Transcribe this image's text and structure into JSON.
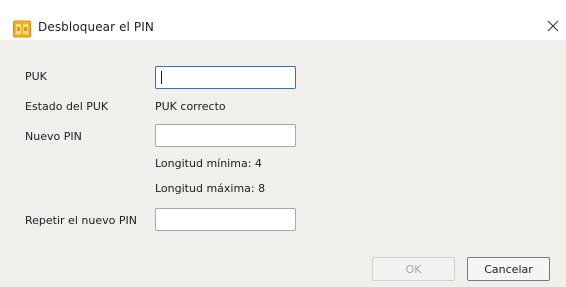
{
  "window": {
    "title": "Desbloquear el PIN",
    "icon": "smartcard-app-icon",
    "close_icon": "close-icon"
  },
  "form": {
    "puk_label": "PUK",
    "puk_value": "",
    "puk_status_label": "Estado del  PUK",
    "puk_status_value": "PUK correcto",
    "new_pin_label": "Nuevo PIN",
    "new_pin_value": "",
    "min_length": "Longitud mínima: 4",
    "max_length": "Longitud máxima: 8",
    "repeat_pin_label": "Repetir el nuevo PIN",
    "repeat_pin_value": ""
  },
  "buttons": {
    "ok_label": "OK",
    "ok_enabled": false,
    "cancel_label": "Cancelar"
  },
  "colors": {
    "background_outside": "#fcdf9a",
    "dialog_body": "#f1efeb",
    "focus_border": "#2f6fcf",
    "icon_orange": "#f0a020"
  }
}
